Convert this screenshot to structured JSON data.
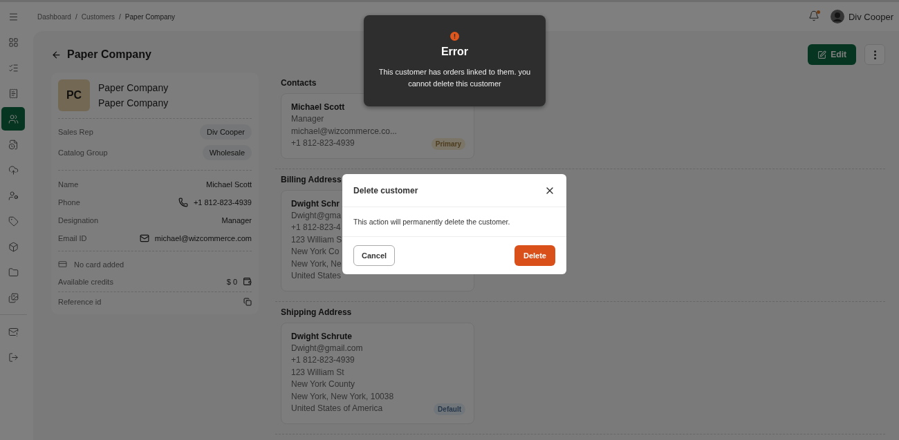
{
  "sidebar": {
    "items": [
      {
        "selected": false
      },
      {
        "selected": false
      },
      {
        "selected": false
      },
      {
        "selected": false
      },
      {
        "selected": true
      },
      {
        "selected": false
      },
      {
        "selected": false
      },
      {
        "selected": false
      },
      {
        "selected": false
      },
      {
        "selected": false
      },
      {
        "selected": false
      },
      {
        "selected": false
      }
    ],
    "bottom_items": [
      {
        "selected": false
      },
      {
        "selected": false
      }
    ]
  },
  "breadcrumbs": [
    "Dashboard",
    "Customers",
    "Paper Company"
  ],
  "breadcrumb_separator": "/",
  "notifications": {
    "unread": true
  },
  "user": {
    "name": "Div Cooper"
  },
  "page": {
    "title": "Paper Company",
    "edit_button": "Edit"
  },
  "profile": {
    "initials": "PC",
    "names": [
      "Paper Company",
      "Paper Company"
    ],
    "tags": [
      {
        "label": "Sales Rep",
        "value": "Div Cooper"
      },
      {
        "label": "Catalog Group",
        "value": "Wholesale"
      }
    ],
    "details": [
      {
        "label": "Name",
        "value": "Michael Scott",
        "kind": "text"
      },
      {
        "label": "Phone",
        "value": "+1 812-823-4939",
        "kind": "phone"
      },
      {
        "label": "Designation",
        "value": "Manager",
        "kind": "text"
      },
      {
        "label": "Email ID",
        "value": "michael@wizcommerce.com",
        "kind": "email"
      }
    ],
    "card": "No card added",
    "credits": {
      "label": "Available credits",
      "value": "$ 0"
    },
    "reference": {
      "label": "Reference id"
    }
  },
  "sections": [
    {
      "title": "Contacts",
      "cards": [
        {
          "name": "Michael Scott",
          "lines": [
            "Manager",
            "michael@wizcommerce.co...",
            "+1 812-823-4939"
          ],
          "badge": {
            "kind": "primary",
            "label": "Primary"
          }
        }
      ]
    },
    {
      "title": "Billing Address",
      "cards": [
        {
          "name": "Dwight Schr",
          "lines": [
            "Dwight@gma",
            "+1 812-823-4",
            "123 William S",
            "New York Co",
            "New York, Ne",
            "United States"
          ]
        }
      ]
    },
    {
      "title": "Shipping Address",
      "cards": [
        {
          "name": "Dwight Schrute",
          "lines": [
            "Dwight@gmail.com",
            "+1 812-823-4939",
            "123 William St",
            "New York County",
            "New York, New York, 10038",
            "United States of America"
          ],
          "badge": {
            "kind": "default",
            "label": "Default"
          }
        }
      ]
    }
  ],
  "toast": {
    "title": "Error",
    "message": "This customer has orders linked to them. you cannot delete this customer"
  },
  "dialog": {
    "title": "Delete customer",
    "message": "This action will permanently delete the customer.",
    "cancel": "Cancel",
    "confirm": "Delete"
  }
}
